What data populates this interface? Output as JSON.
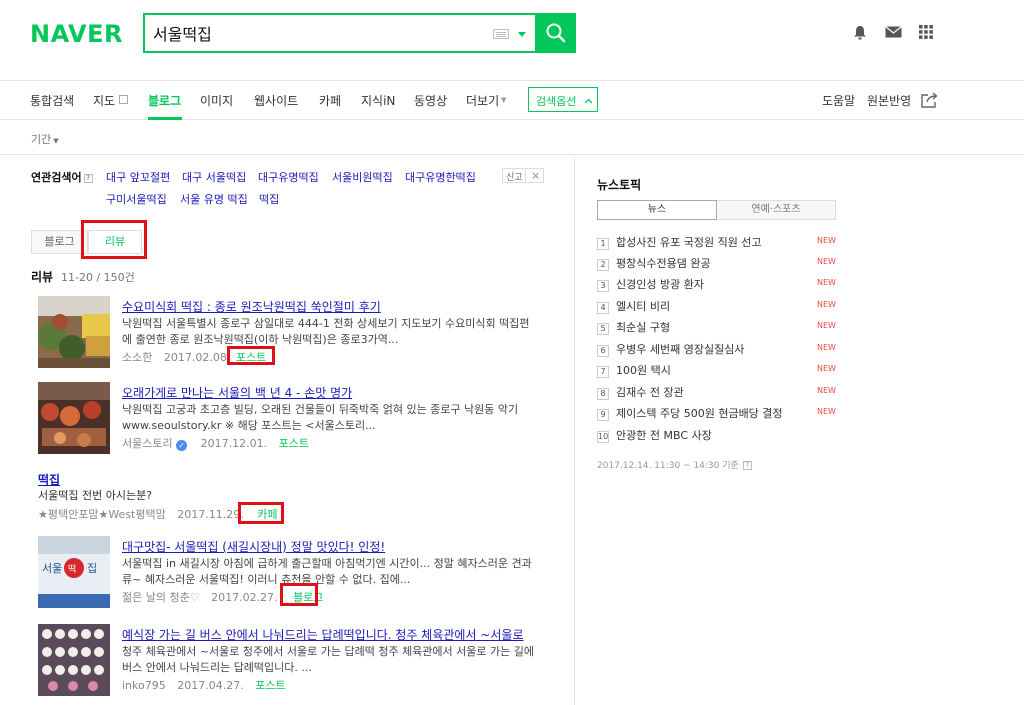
{
  "header": {
    "logo": "NAVER",
    "search_value": "서울떡집"
  },
  "tabs": {
    "items": [
      "통합검색",
      "지도",
      "블로그",
      "이미지",
      "웹사이트",
      "카페",
      "지식iN",
      "동영상",
      "더보기"
    ],
    "active": "블로그",
    "search_options": "검색옵션",
    "right": [
      "도움말",
      "원본반영"
    ]
  },
  "filter": {
    "period": "기간"
  },
  "related": {
    "label": "연관검색어",
    "help": "?",
    "links": [
      "대구 앞꼬절편",
      "대구 서울떡집",
      "대구유명떡집",
      "서울비원떡집",
      "대구유명한떡집",
      "구미서울떡집",
      "서울 유명 떡집",
      "떡집"
    ],
    "report": "신고"
  },
  "segments": {
    "blog": "블로그",
    "review": "리뷰"
  },
  "results": {
    "heading": "리뷰",
    "count": "11-20 / 150건",
    "items": [
      {
        "title": "수요미식회 떡집 : 종로 원조낙원떡집 쑥인절미 후기",
        "desc": [
          "낙원떡집 서울특별시 종로구 삼일대로 444-1 전화 상세보기 지도보기 수요미식회 떡집편",
          "에 출연한 종로 원조낙원떡집(이하 낙원떡집)은 종로3가역..."
        ],
        "author": "소소한",
        "date": "2017.02.08.",
        "source": "포스트"
      },
      {
        "title": "오래가게로 만나는 서울의 백 년 4 - 손맛 명가",
        "desc": [
          "낙원떡집 고궁과 초고층 빌딩, 오래된 건물들이 뒤죽박죽 얽혀 있는 종로구 낙원동 악기",
          "www.seoulstory.kr ※ 해당 포스트는 <서울스토리..."
        ],
        "author": "서울스토리",
        "date": "2017.12.01.",
        "source": "포스트"
      },
      {
        "title": "떡집",
        "desc": [
          "서울떡집 전번 아시는분?"
        ],
        "author": "★평택안포맘★West평택맘",
        "date": "2017.11.29.",
        "source": "카페"
      },
      {
        "title": "대구맛집- 서울떡집 (새길시장내) 정말 맛있다! 인정!",
        "desc": [
          "서울떡집 in 새길시장 아침에 급하게 출근할때 아침먹기엔 시간이... 정말 혜자스러운 견과",
          "류~ 혜자스러운 서울떡집! 이러니 츄천을 안할 수 없다. 집에..."
        ],
        "author": "젊은 날의 청춘♡",
        "date": "2017.02.27.",
        "source": "블로그",
        "thumb_text": "서울 떡 집"
      },
      {
        "title": "예식장 가는 길 버스 안에서 나눠드리는 답례떡입니다. 청주 체육관에서 ~서울로",
        "desc": [
          "청주 체육관에서 ~서울로 청주에서 서울로 가는 답례떡 청주 체육관에서 서울로 가는 길에",
          "버스 안에서 나눠드리는 답례떡입니다. ..."
        ],
        "author": "inko795",
        "date": "2017.04.27.",
        "source": "포스트"
      }
    ]
  },
  "news": {
    "title": "뉴스토픽",
    "tabs": [
      "뉴스",
      "연예·스포츠"
    ],
    "new_label": "NEW",
    "items": [
      {
        "num": "1",
        "text": "합성사진 유포 국정원 직원 선고",
        "new": true
      },
      {
        "num": "2",
        "text": "평창식수전용댐 완공",
        "new": true
      },
      {
        "num": "3",
        "text": "신경인성 방광 환자",
        "new": true
      },
      {
        "num": "4",
        "text": "엘시티 비리",
        "new": true
      },
      {
        "num": "5",
        "text": "최순실 구형",
        "new": true
      },
      {
        "num": "6",
        "text": "우병우 세번째 영장실질심사",
        "new": true
      },
      {
        "num": "7",
        "text": "100원 택시",
        "new": true
      },
      {
        "num": "8",
        "text": "김재수 전 장관",
        "new": true
      },
      {
        "num": "9",
        "text": "제이스텍 주당 500원 현금배당 결정",
        "new": true
      },
      {
        "num": "10",
        "text": "안광한 전 MBC 사장",
        "new": false
      }
    ],
    "time": "2017.12.14. 11:30 ~ 14:30 기준",
    "time_help": "?"
  },
  "colors": {
    "brand": "#03c75a",
    "link": "#1a1ab8",
    "highlight_box": "#e0101a",
    "new": "#e84a3c"
  }
}
